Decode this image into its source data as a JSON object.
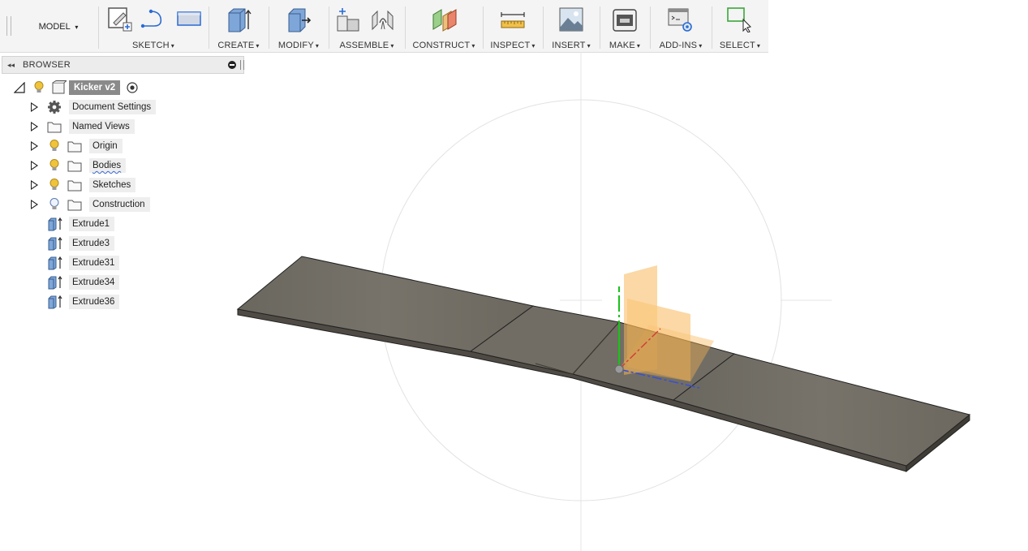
{
  "toolbar": {
    "model_label": "MODEL",
    "groups": [
      {
        "label": "SKETCH"
      },
      {
        "label": "CREATE"
      },
      {
        "label": "MODIFY"
      },
      {
        "label": "ASSEMBLE"
      },
      {
        "label": "CONSTRUCT"
      },
      {
        "label": "INSPECT"
      },
      {
        "label": "INSERT"
      },
      {
        "label": "MAKE"
      },
      {
        "label": "ADD-INS"
      },
      {
        "label": "SELECT"
      }
    ],
    "caret": "▾"
  },
  "browser": {
    "title": "BROWSER",
    "collapse_glyph": "◂◂",
    "root": {
      "label": "Kicker v2"
    },
    "items": [
      {
        "label": "Document Settings",
        "icon": "gear-icon"
      },
      {
        "label": "Named Views",
        "icon": "folder-icon"
      },
      {
        "label": "Origin",
        "icon": "folder-icon",
        "visibility": "on"
      },
      {
        "label": "Bodies",
        "icon": "folder-icon",
        "visibility": "on"
      },
      {
        "label": "Sketches",
        "icon": "folder-icon",
        "visibility": "on"
      },
      {
        "label": "Construction",
        "icon": "folder-icon",
        "visibility": "partial"
      },
      {
        "label": "Extrude1",
        "icon": "extrude-icon"
      },
      {
        "label": "Extrude3",
        "icon": "extrude-icon"
      },
      {
        "label": "Extrude31",
        "icon": "extrude-icon"
      },
      {
        "label": "Extrude34",
        "icon": "extrude-icon"
      },
      {
        "label": "Extrude36",
        "icon": "extrude-icon"
      }
    ]
  },
  "colors": {
    "body_top": "#6f6b62",
    "body_side": "#4e4a43",
    "plane_orange": "#f6b24a",
    "axis_green": "#19c21a",
    "axis_red": "#d43a3a",
    "axis_blue": "#3a4fd4",
    "bulb_yellow": "#f0c43a"
  }
}
